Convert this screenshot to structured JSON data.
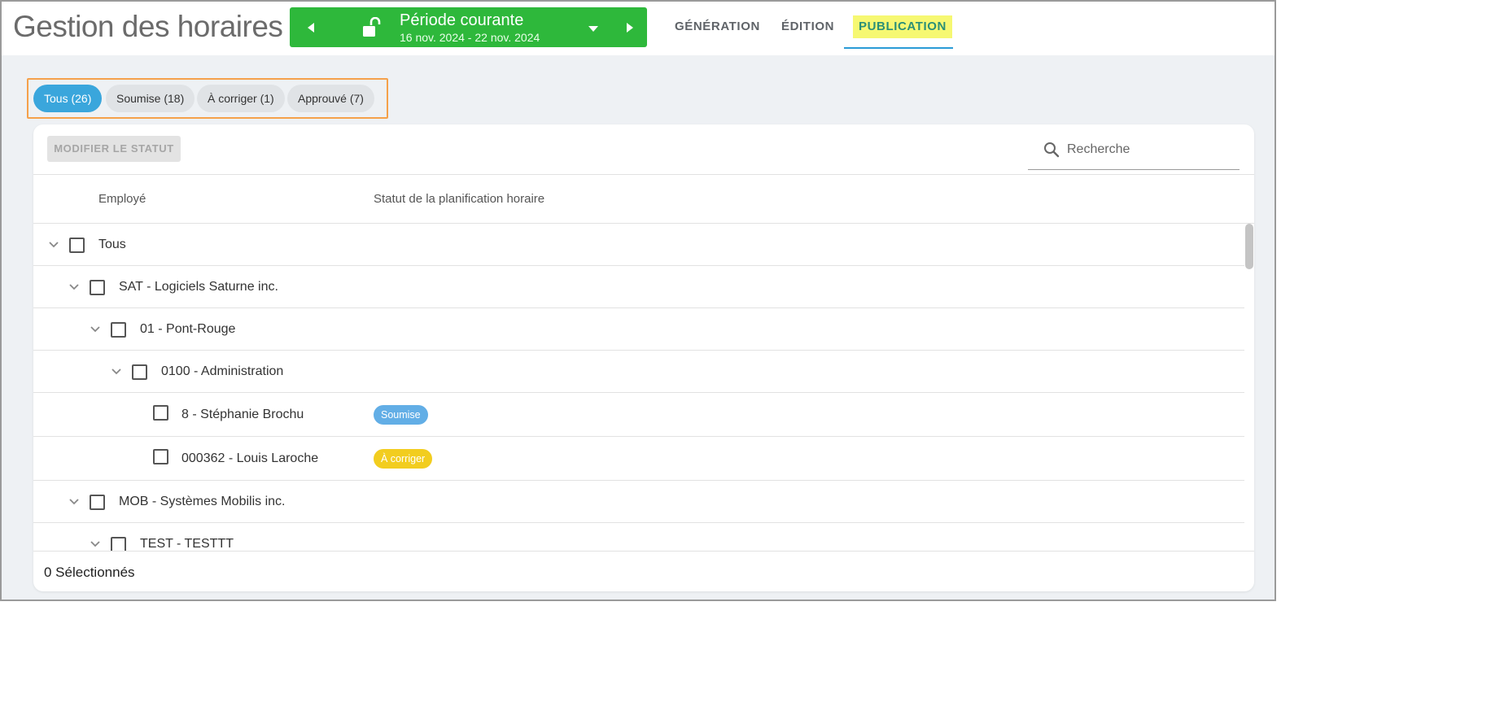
{
  "header": {
    "title": "Gestion des horaires",
    "period": {
      "label": "Période courante",
      "dates": "16 nov. 2024 - 22 nov. 2024"
    },
    "tabs": [
      {
        "label": "GÉNÉRATION"
      },
      {
        "label": "ÉDITION"
      },
      {
        "label": "PUBLICATION"
      }
    ],
    "active_tab": "PUBLICATION"
  },
  "filters": [
    {
      "label": "Tous (26)",
      "active": true
    },
    {
      "label": "Soumise (18)",
      "active": false
    },
    {
      "label": "À corriger (1)",
      "active": false
    },
    {
      "label": "Approuvé (7)",
      "active": false
    }
  ],
  "toolbar": {
    "modify_status_label": "MODIFIER LE STATUT",
    "search_placeholder": "Recherche"
  },
  "table": {
    "columns": [
      "Employé",
      "Statut de la planification horaire"
    ],
    "rows": [
      {
        "label": "Tous",
        "level": 0,
        "expandable": true,
        "status": ""
      },
      {
        "label": "SAT - Logiciels Saturne inc.",
        "level": 1,
        "expandable": true,
        "status": ""
      },
      {
        "label": "01 - Pont-Rouge",
        "level": 2,
        "expandable": true,
        "status": ""
      },
      {
        "label": "0100 - Administration",
        "level": 3,
        "expandable": true,
        "status": ""
      },
      {
        "label": "8 - Stéphanie Brochu",
        "level": 4,
        "expandable": false,
        "status": "Soumise"
      },
      {
        "label": "000362 - Louis Laroche",
        "level": 4,
        "expandable": false,
        "status": "À corriger"
      },
      {
        "label": "MOB - Systèmes Mobilis inc.",
        "level": 1,
        "expandable": true,
        "status": ""
      },
      {
        "label": "TEST - TESTTT",
        "level": 2,
        "expandable": true,
        "status": ""
      }
    ]
  },
  "status_colors": {
    "Soumise": "#62aee6",
    "À corriger": "#f2cd1f"
  },
  "footer": {
    "selected": "0 Sélectionnés"
  },
  "colors": {
    "period_bg": "#2eb83b",
    "active_chip": "#3aa6dc",
    "filter_border": "#f5a14a",
    "tab_highlight": "#f6f872"
  }
}
